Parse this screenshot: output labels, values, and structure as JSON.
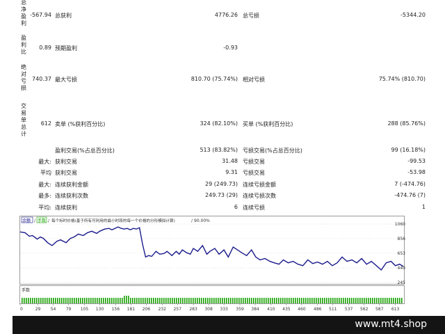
{
  "side_labels": {
    "net_profit": "总净盈利",
    "profit_factor": "盈利比",
    "abs_drawdown": "绝对亏损",
    "total_trades": "交易单总计"
  },
  "row1": {
    "v1": "-567.94",
    "l2": "总获利",
    "v2": "4776.26",
    "l3": "总亏损",
    "v3": "-5344.20"
  },
  "row2": {
    "v1": "0.89",
    "l2": "预期盈利",
    "v2": "-0.93"
  },
  "row3": {
    "v1": "740.37",
    "l2": "最大亏损",
    "v2": "810.70 (75.74%)",
    "l3": "相对亏损",
    "v3": "75.74% (810.70)"
  },
  "row4": {
    "v1": "612",
    "l2": "卖单 (%获利百分比)",
    "v2": "324 (82.10%)",
    "l3": "买单 (%获利百分比)",
    "v3": "288 (85.76%)"
  },
  "row5": {
    "l2": "盈利交易(%占总百分比)",
    "v2": "513 (83.82%)",
    "l3": "亏损交易(%占总百分比)",
    "v3": "99 (16.18%)"
  },
  "row6": {
    "p": "最大:",
    "l2": "获利交易",
    "v2": "31.48",
    "l3": "亏损交易",
    "v3": "-99.53"
  },
  "row7": {
    "p": "平均",
    "l2": "获利交易",
    "v2": "9.31",
    "l3": "亏损交易",
    "v3": "-53.98"
  },
  "row8": {
    "p": "最大:",
    "l2": "连续获利金额",
    "v2": "29 (249.73)",
    "l3": "连续亏损金额",
    "v3": "7 (-474.76)"
  },
  "row9": {
    "p": "最多:",
    "l2": "连续获利次数",
    "v2": "249.73 (29)",
    "l3": "连续亏损次数",
    "v3": "-474.76 (7)"
  },
  "row10": {
    "p": "平均:",
    "l2": "连续获利",
    "v2": "6",
    "l3": "连续亏损",
    "v3": "1"
  },
  "chart": {
    "legend_balance": "余额",
    "legend_volume_chip": "手数",
    "legend_text": "每个标时价格(基于所有可利用的最小时段的每一个价格的分形模拟计算)",
    "legend_quality": "90.00%",
    "volume_label": "手数",
    "colors": {
      "line": "#1a1a8c",
      "volume": "#16a000",
      "grid": "#d8d8d8",
      "border": "#9a9a9a"
    }
  },
  "chart_data": {
    "type": "line",
    "x_ticks": [
      "0",
      "29",
      "54",
      "79",
      "105",
      "130",
      "156",
      "181",
      "206",
      "232",
      "257",
      "283",
      "308",
      "333",
      "359",
      "384",
      "410",
      "435",
      "460",
      "486",
      "511",
      "537",
      "562",
      "587",
      "613"
    ],
    "y_ticks": [
      "1060",
      "856",
      "653",
      "449",
      "245"
    ],
    "ylim": [
      245,
      1060
    ],
    "xlim": [
      0,
      626
    ],
    "x": [
      0,
      8,
      15,
      20,
      28,
      33,
      38,
      45,
      52,
      60,
      66,
      75,
      82,
      88,
      95,
      103,
      110,
      117,
      125,
      130,
      138,
      145,
      150,
      155,
      160,
      165,
      170,
      175,
      180,
      185,
      190,
      195,
      200,
      205,
      210,
      215,
      222,
      228,
      235,
      240,
      248,
      255,
      260,
      265,
      272,
      278,
      283,
      290,
      298,
      305,
      310,
      318,
      325,
      333,
      340,
      348,
      355,
      362,
      370,
      378,
      385,
      392,
      400,
      408,
      415,
      423,
      430,
      438,
      446,
      454,
      462,
      470,
      478,
      486,
      494,
      502,
      510,
      518,
      526,
      534,
      542,
      550,
      558,
      566,
      574,
      582,
      590,
      598,
      606,
      613,
      620,
      626
    ],
    "y": [
      950,
      940,
      890,
      900,
      850,
      880,
      860,
      800,
      760,
      820,
      840,
      800,
      860,
      880,
      920,
      900,
      940,
      960,
      930,
      960,
      990,
      1000,
      980,
      1000,
      1020,
      1000,
      990,
      1000,
      980,
      1000,
      990,
      1010,
      780,
      600,
      620,
      610,
      680,
      640,
      650,
      680,
      620,
      680,
      640,
      700,
      660,
      640,
      720,
      680,
      760,
      640,
      680,
      720,
      640,
      700,
      600,
      740,
      700,
      660,
      620,
      700,
      600,
      560,
      580,
      540,
      520,
      500,
      560,
      520,
      540,
      500,
      480,
      560,
      510,
      530,
      500,
      540,
      480,
      520,
      600,
      540,
      560,
      520,
      580,
      500,
      540,
      480,
      420,
      520,
      540,
      480,
      500,
      470
    ]
  },
  "footer_url": "www.mt4.shop"
}
